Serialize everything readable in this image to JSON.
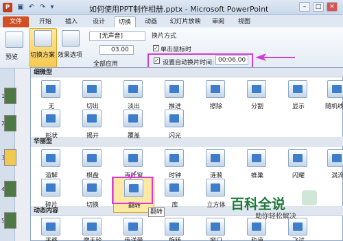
{
  "window": {
    "title": "如何使用PPT制作相册.pptx - Microsoft PowerPoint",
    "app_icon": "P"
  },
  "tabs": [
    "文件",
    "开始",
    "插入",
    "设计",
    "切换",
    "动画",
    "幻灯片放映",
    "审阅",
    "视图"
  ],
  "ribbon": {
    "preview_label": "预览",
    "preview_group": "预览",
    "transition_scheme_label": "切换方案",
    "effect_options_label": "效果选项",
    "sound_select": "[无声音]",
    "duration": "03.00",
    "apply_all": "全部应用",
    "switch_mode_label": "换片方式",
    "on_mouse_click": "单击鼠标时",
    "auto_after_label": "设置自动换片时间:",
    "auto_after_value": "00:06.00"
  },
  "slides": [
    "1",
    "2",
    "3",
    "4",
    "5"
  ],
  "gallery": {
    "sections": [
      "细微型",
      "华丽型",
      "动态内容"
    ],
    "subtle": [
      "无",
      "切出",
      "淡出",
      "推进",
      "擦除",
      "分割",
      "显示",
      "随机线条",
      "形状",
      "揭开",
      "覆盖",
      "闪光"
    ],
    "exciting": [
      "溶解",
      "棋盘",
      "百叶窗",
      "时钟",
      "涟漪",
      "蜂巢",
      "闪耀",
      "涡流",
      "碎片",
      "切换",
      "翻转",
      "库",
      "立方体"
    ],
    "dynamic": [
      "平移",
      "摩天轮",
      "传送带",
      "旋转",
      "窗口",
      "轨道",
      "飞过"
    ],
    "tooltip": "翻转"
  },
  "watermark": {
    "title": "百科全说",
    "subtitle": "助你轻松解决"
  },
  "colors": {
    "file_tab": "#d14f23",
    "highlight": "#d63bd4",
    "selected_item": "#fde9a6"
  }
}
